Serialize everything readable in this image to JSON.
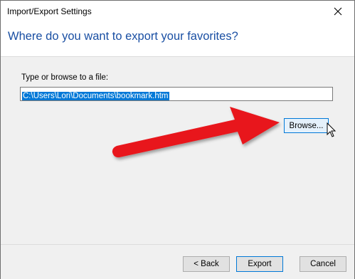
{
  "window": {
    "title": "Import/Export Settings"
  },
  "header": {
    "heading": "Where do you want to export your favorites?"
  },
  "form": {
    "file_label": "Type or browse to a file:",
    "file_path": "C:\\Users\\Lori\\Documents\\bookmark.htm",
    "browse_label": "Browse..."
  },
  "footer": {
    "back_label": "< Back",
    "export_label": "Export",
    "cancel_label": "Cancel"
  },
  "icons": {
    "close": "close-icon",
    "cursor": "mouse-pointer-icon",
    "annotation": "red-arrow-icon"
  },
  "colors": {
    "heading": "#1a4fa3",
    "selection": "#0078d7",
    "annotation_arrow": "#e8191b"
  }
}
